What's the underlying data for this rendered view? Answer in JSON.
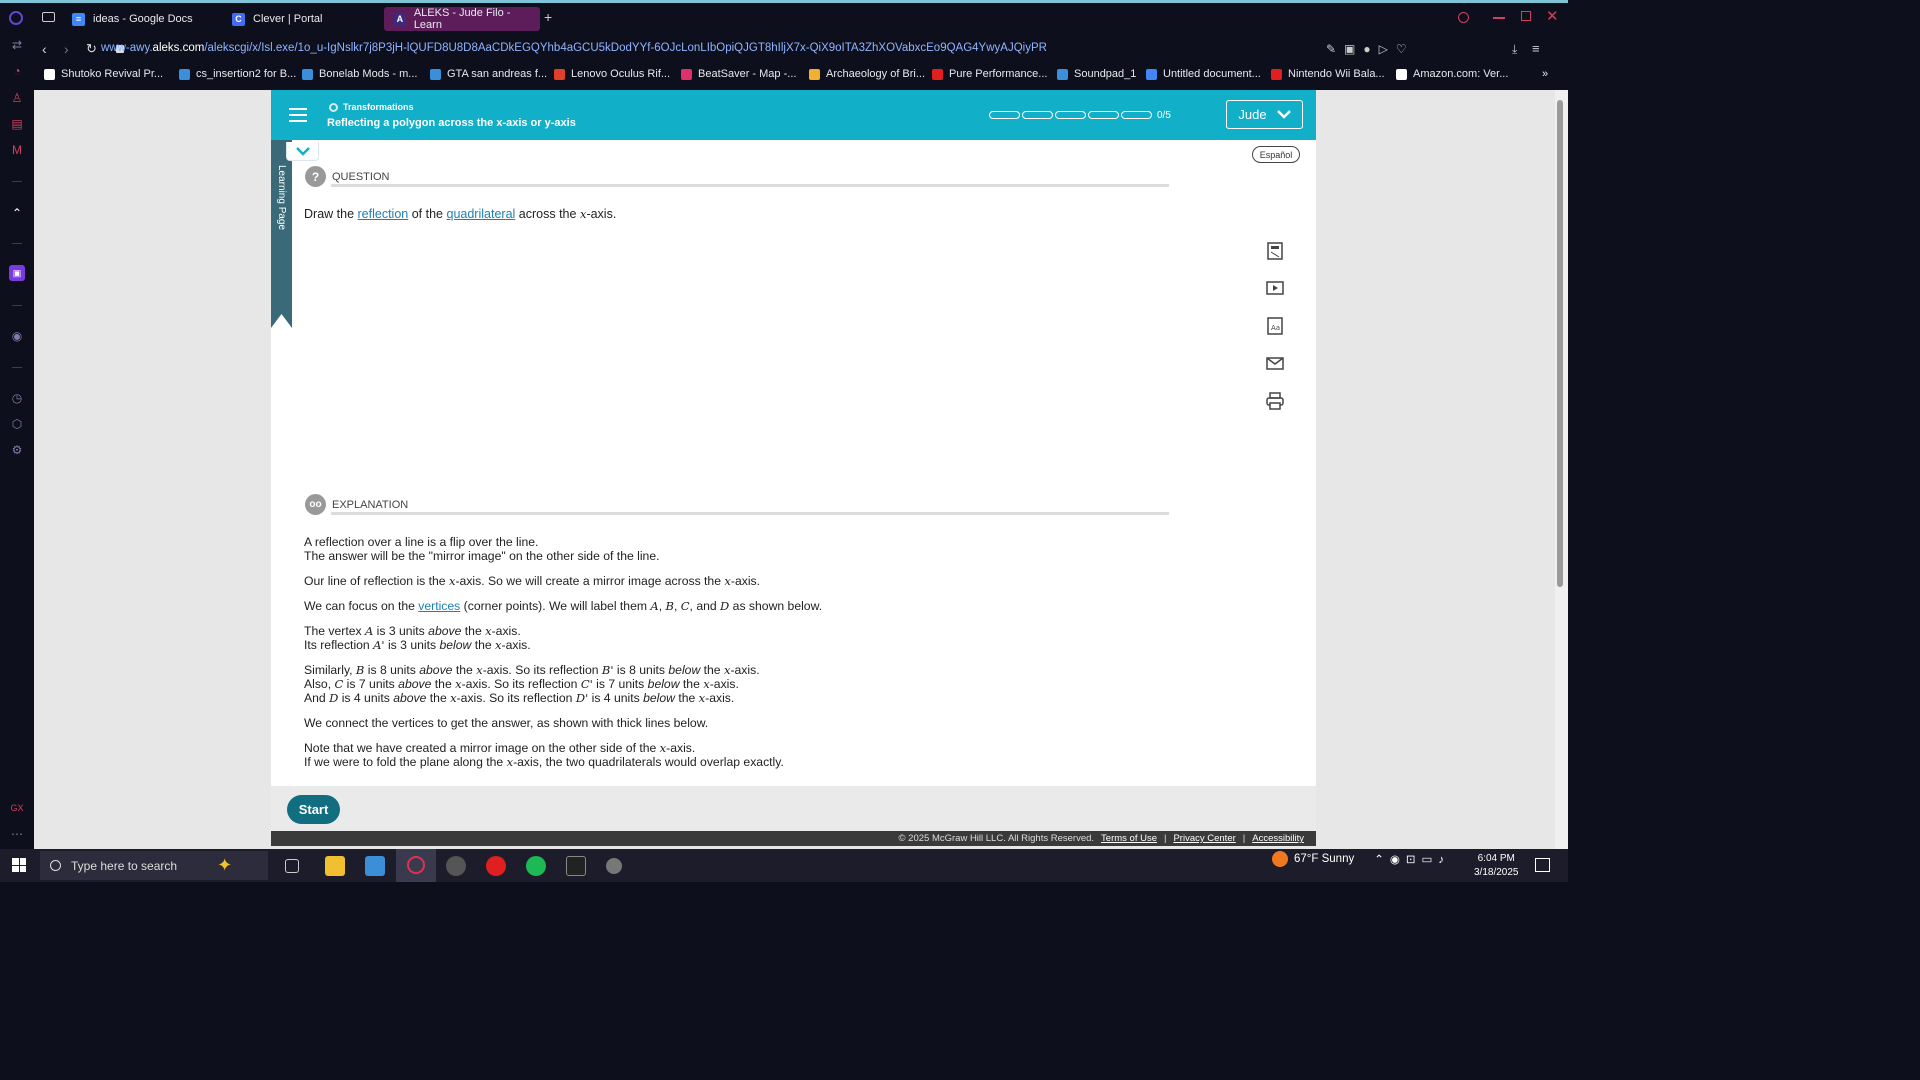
{
  "browser": {
    "tabs": [
      {
        "title": "ideas - Google Docs",
        "icon": "google-docs-icon",
        "color": "#4285f4"
      },
      {
        "title": "Clever | Portal",
        "icon": "clever-icon",
        "color": "#436cf2"
      },
      {
        "title": "ALEKS - Jude Filo - Learn",
        "icon": "aleks-icon",
        "color": "#5d1d5a"
      }
    ],
    "url_host": "www-awy.",
    "url_domain": "aleks.com",
    "url_path": "/alekscgi/x/Isl.exe/1o_u-IgNslkr7j8P3jH-lQUFD8U8D8AaCDkEGQYhb4aGCU5kDodYYf-6OJcLonLIbOpiQJGT8hIljX7x-QiX9oITA3ZhXOVabxcEo9QAG4YwyAJQiyPR",
    "bookmarks": [
      {
        "label": "Shutoko Revival Pr...",
        "color": "#ffffff"
      },
      {
        "label": "cs_insertion2 for B...",
        "color": "#3a8fd8"
      },
      {
        "label": "Bonelab Mods - m...",
        "color": "#3a8fd8"
      },
      {
        "label": "GTA san andreas f...",
        "color": "#3a8fd8"
      },
      {
        "label": "Lenovo Oculus Rif...",
        "color": "#e0402a"
      },
      {
        "label": "BeatSaver - Map -...",
        "color": "#e0306a"
      },
      {
        "label": "Archaeology of Bri...",
        "color": "#f0b030"
      },
      {
        "label": "Pure Performance...",
        "color": "#e02020"
      },
      {
        "label": "Soundpad_1",
        "color": "#3a8fd8"
      },
      {
        "label": "Untitled document...",
        "color": "#4285f4"
      },
      {
        "label": "Nintendo Wii Bala...",
        "color": "#e02020"
      },
      {
        "label": "Amazon.com: Ver...",
        "color": "#ffffff"
      }
    ]
  },
  "aleks": {
    "topic": "Transformations",
    "subtopic": "Reflecting a polygon across the x-axis or y-axis",
    "progress": {
      "value": 0,
      "total": 5,
      "text": "0/5"
    },
    "user": "Jude",
    "learning_page": "Learning Page",
    "espanol": "Español",
    "question_heading": "QUESTION",
    "question": {
      "w1": "Draw the",
      "link1": "reflection",
      "w2": "of the",
      "link2": "quadrilateral",
      "w3": "across the",
      "var": "x",
      "w4": "-axis."
    },
    "explanation_heading": "EXPLANATION",
    "explanation": {
      "l1": "A reflection over a line is a flip over the line.",
      "l2": "The answer will be the \"mirror image\" on the other side of the line.",
      "l3a": "Our line of reflection is the",
      "l3b": "-axis. So we will create a mirror image across the",
      "l3c": "-axis.",
      "l4a": "We can focus on the",
      "l4link": "vertices",
      "l4b": "(corner points). We will label them",
      "l4c": "as shown below.",
      "l5a": "The vertex",
      "l5b": "is 3 units",
      "l5c": "above",
      "l5d": "the",
      "l5e": "-axis.",
      "l6a": "Its reflection",
      "l6b": "is 3 units",
      "l6c": "below",
      "l6d": "the",
      "l6e": "-axis.",
      "l7": "We connect the vertices to get the answer, as shown with thick lines below.",
      "l8a": "Note that we have created a mirror image on the other side of the",
      "l8b": "-axis.",
      "l9a": "If we were to fold the plane along the",
      "l9b": "-axis, the two quadrilaterals would overlap exactly."
    },
    "start": "Start",
    "copyright": "© 2025 McGraw Hill LLC. All Rights Reserved.",
    "footer_links": [
      "Terms of Use",
      "Privacy Center",
      "Accessibility"
    ]
  },
  "taskbar": {
    "search_placeholder": "Type here to search",
    "weather": "67°F  Sunny",
    "time": "6:04 PM",
    "date": "3/18/2025"
  }
}
